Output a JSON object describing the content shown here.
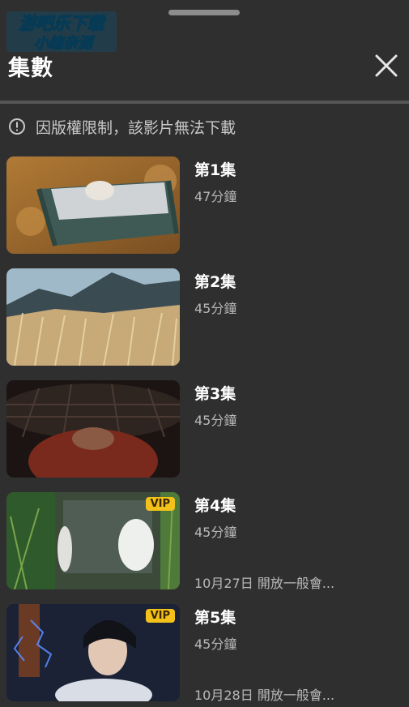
{
  "watermark": {
    "line1": "游吧乐下载",
    "line2": "小编亲测"
  },
  "header": {
    "title": "集數"
  },
  "notice": {
    "text": "因版權限制，該影片無法下載"
  },
  "episodes": [
    {
      "title": "第1集",
      "duration": "47分鐘",
      "vip": "",
      "note": ""
    },
    {
      "title": "第2集",
      "duration": "45分鐘",
      "vip": "",
      "note": ""
    },
    {
      "title": "第3集",
      "duration": "45分鐘",
      "vip": "",
      "note": ""
    },
    {
      "title": "第4集",
      "duration": "45分鐘",
      "vip": "VIP",
      "note": "10月27日 開放一般會..."
    },
    {
      "title": "第5集",
      "duration": "45分鐘",
      "vip": "VIP",
      "note": "10月28日 開放一般會..."
    }
  ]
}
